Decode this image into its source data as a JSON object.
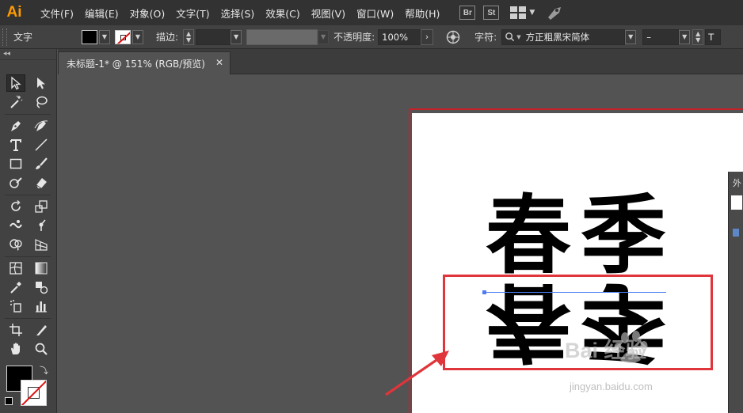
{
  "app": {
    "logo": "Ai",
    "brand_color": "#ff9a00"
  },
  "menu": {
    "items": [
      "文件(F)",
      "编辑(E)",
      "对象(O)",
      "文字(T)",
      "选择(S)",
      "效果(C)",
      "视图(V)",
      "窗口(W)",
      "帮助(H)"
    ],
    "bridge_label": "Br",
    "stock_label": "St",
    "icons": [
      "workspace-grid-icon",
      "gpu-rocket-icon"
    ]
  },
  "control_bar": {
    "tool_name": "文字",
    "stroke_label": "描边",
    "stroke_colon": ":",
    "opacity_label": "不透明度",
    "opacity_colon": ":",
    "opacity_value": "100%",
    "char_label": "字符",
    "char_colon": ":",
    "font_family": "方正粗黑宋简体",
    "font_style": "–",
    "size_prefix": "T"
  },
  "tools": [
    "selection-tool-icon",
    "direct-selection-tool-icon",
    "magic-wand-tool-icon",
    "lasso-tool-icon",
    "pen-tool-icon",
    "curvature-tool-icon",
    "type-tool-icon",
    "line-tool-icon",
    "rectangle-tool-icon",
    "paintbrush-tool-icon",
    "shaper-tool-icon",
    "eraser-tool-icon",
    "rotate-tool-icon",
    "scale-tool-icon",
    "warp-tool-icon",
    "puppet-warp-tool-icon",
    "shape-builder-tool-icon",
    "perspective-grid-tool-icon",
    "mesh-tool-icon",
    "gradient-tool-icon",
    "eyedropper-tool-icon",
    "blend-tool-icon",
    "symbol-sprayer-tool-icon",
    "column-graph-tool-icon",
    "artboard-tool-icon",
    "slice-tool-icon",
    "hand-tool-icon",
    "zoom-tool-icon"
  ],
  "document": {
    "tab_title": "未标题-1* @ 151% (RGB/预览)",
    "close_glyph": "✕"
  },
  "artwork": {
    "char_1": "春",
    "char_2": "季",
    "highlight_color": "#e0353a",
    "baseline_color": "#4d7cf5"
  },
  "side_panel": {
    "title_glyph": "外"
  },
  "watermark": {
    "text": "Bai 经验",
    "url": "jingyan.baidu.com"
  }
}
